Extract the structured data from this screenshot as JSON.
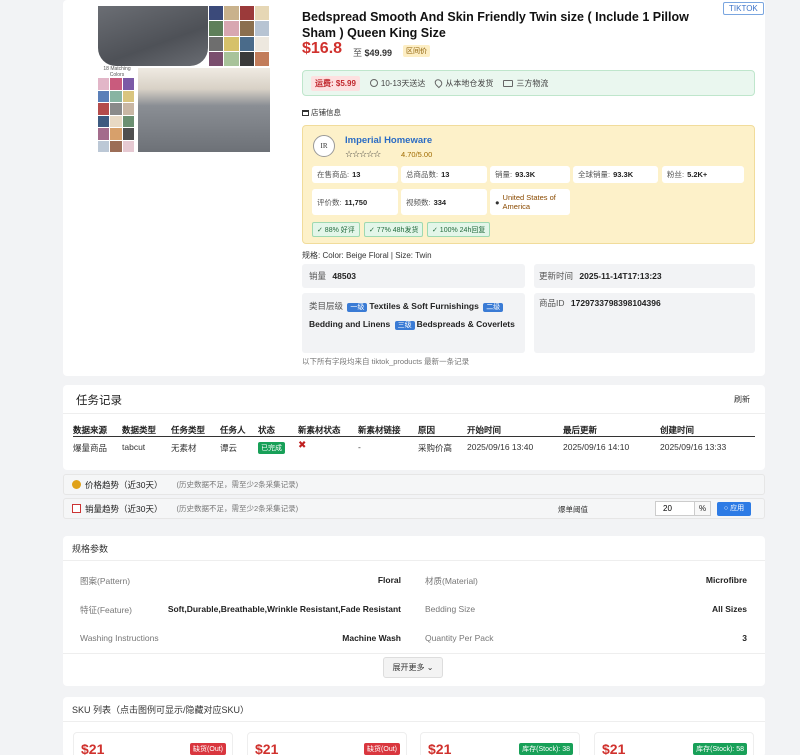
{
  "product": {
    "title": "Bedspread Smooth And Skin Friendly Twin size ( Include 1 Pillow Sham ) Queen King Size",
    "platform_badge": "TIKTOK",
    "price": "$16.8",
    "price_range_prefix": "至",
    "price_range_max": "$49.99",
    "price_tag": "区间价",
    "image_caption": "18 Matching Colors"
  },
  "shipping": {
    "fee": "运费: $5.99",
    "delivery": "10-13天送达",
    "origin": "从本地仓发货",
    "logistics": "三方物流"
  },
  "shop": {
    "section_label": "店铺信息",
    "logo_text": "IR",
    "name": "Imperial Homeware",
    "stars": "☆☆☆☆☆",
    "rating": "4.70/5.00",
    "on_sale_label": "在售商品:",
    "on_sale": "13",
    "total_label": "总商品数:",
    "total": "13",
    "sales_label": "销量:",
    "sales": "93.3K",
    "global_sales_label": "全球销量:",
    "global_sales": "93.3K",
    "fans_label": "粉丝:",
    "fans": "5.2K+",
    "reviews_label": "评价数:",
    "reviews": "11,750",
    "videos_label": "视频数:",
    "videos": "334",
    "country": "United States of America",
    "chip_positive": "✓ 88% 好评",
    "chip_ship48": "✓ 77% 48h发货",
    "chip_reply24": "✓ 100% 24h回复"
  },
  "variant": "规格: Color: Beige Floral | Size: Twin",
  "info": {
    "sales_label": "销量",
    "sales_value": "48503",
    "updated_label": "更新时间",
    "updated_value": "2025-11-14T17:13:23",
    "category_label": "类目层级",
    "level1": "一级",
    "cat1": "Textiles & Soft Furnishings",
    "level2": "二级",
    "cat2": "Bedding and Linens",
    "level3": "三级",
    "cat3": "Bedspreads & Coverlets",
    "product_id_label": "商品ID",
    "product_id": "1729733798398104396",
    "footnote": "以下所有字段均来自 tiktok_products 最新一条记录"
  },
  "task": {
    "title": "任务记录",
    "refresh": "刷新",
    "columns": [
      "数据来源",
      "数据类型",
      "任务类型",
      "任务人",
      "状态",
      "新素材状态",
      "新素材链接",
      "原因",
      "开始时间",
      "最后更新",
      "创建时间"
    ],
    "row": {
      "source": "爆量商品",
      "type": "tabcut",
      "task_type": "无素材",
      "assignee": "谭云",
      "status": "已完成",
      "material_status": "✖",
      "material_link": "-",
      "reason": "采购价高",
      "start": "2025/09/16 13:40",
      "updated": "2025/09/16 14:10",
      "created": "2025/09/16 13:33"
    }
  },
  "price_trend": {
    "label": "价格趋势（近30天）",
    "hint": "(历史数据不足，需至少2条采集记录)"
  },
  "sales_trend": {
    "label": "销量趋势（近30天）",
    "hint": "(历史数据不足，需至少2条采集记录)",
    "alert_label": "爆单阈值",
    "alert_value": "20",
    "alert_unit": "%",
    "apply": "○ 应用"
  },
  "specs": {
    "title": "规格参数",
    "items": [
      {
        "k": "图案(Pattern)",
        "v": "Floral"
      },
      {
        "k": "材质(Material)",
        "v": "Microfibre"
      },
      {
        "k": "特征(Feature)",
        "v": "Soft,Durable,Breathable,Wrinkle Resistant,Fade Resistant"
      },
      {
        "k": "Bedding Size",
        "v": "All Sizes"
      },
      {
        "k": "Washing Instructions",
        "v": "Machine Wash"
      },
      {
        "k": "Quantity Per Pack",
        "v": "3"
      }
    ],
    "more": "展开更多 ⌄"
  },
  "sku": {
    "title": "SKU 列表（点击图例可显示/隐藏对应SKU）",
    "items": [
      {
        "price": "$21",
        "tag": "缺货(Out)"
      },
      {
        "price": "$21",
        "tag": "缺货(Out)"
      },
      {
        "price": "$21",
        "tag": "库存(Stock): 38"
      },
      {
        "price": "$21",
        "tag": "库存(Stock): 58"
      }
    ]
  },
  "colors": {
    "accent": "#2d7be5",
    "price": "#d0312d",
    "success": "#18a058"
  }
}
